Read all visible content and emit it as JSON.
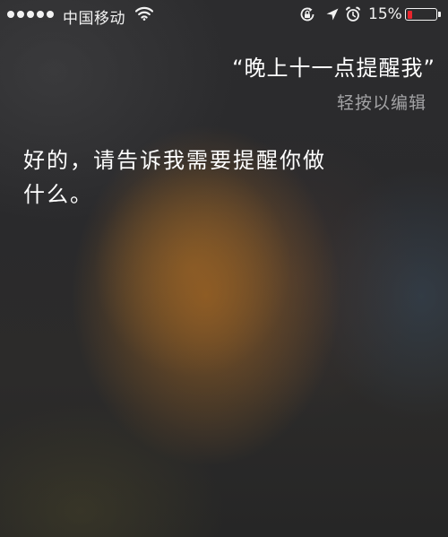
{
  "status_bar": {
    "carrier": "中国移动",
    "battery_percent": "15%",
    "battery_level": 0.15,
    "battery_color": "#e8252d",
    "icons": [
      "signal-dots-icon",
      "wifi-icon",
      "rotation-lock-icon",
      "location-arrow-icon",
      "alarm-clock-icon",
      "battery-icon"
    ]
  },
  "siri": {
    "user_query": "“晚上十一点提醒我”",
    "tap_to_edit": "轻按以编辑",
    "response_line1": "好的，请告诉我需要提醒你做",
    "response_line2": "什么。"
  },
  "colors": {
    "text": "#ffffff",
    "secondary_text": "#a3a3a5"
  }
}
